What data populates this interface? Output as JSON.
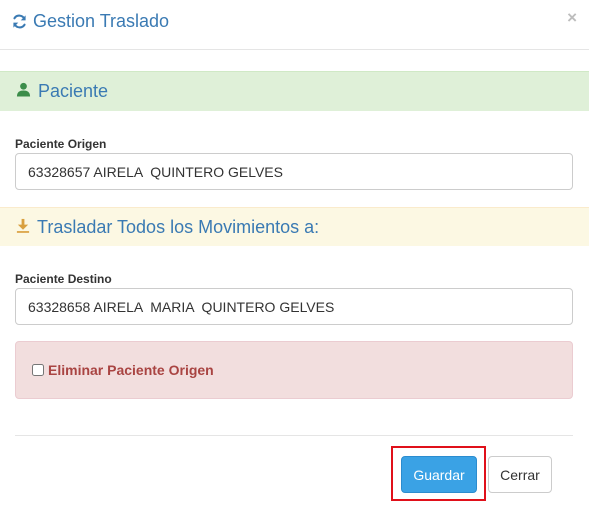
{
  "modal": {
    "title": "Gestion Traslado",
    "close_symbol": "×",
    "title_icon": "refresh-icon"
  },
  "section_patient": {
    "heading": "Paciente",
    "icon": "user-icon",
    "color": "#dff0d8"
  },
  "origin": {
    "label": "Paciente Origen",
    "value": "63328657 AIRELA  QUINTERO GELVES"
  },
  "section_transfer": {
    "heading": "Trasladar Todos los Movimientos a:",
    "icon": "download-icon",
    "color": "#fcf8e3"
  },
  "destination": {
    "label": "Paciente Destino",
    "value": "63328658 AIRELA  MARIA  QUINTERO GELVES"
  },
  "delete_origin": {
    "label": "Eliminar Paciente Origen",
    "checked": false,
    "color": "#a94442"
  },
  "footer": {
    "save_label": "Guardar",
    "close_label": "Cerrar",
    "accent": "#3aa2e5",
    "highlight_color": "#e0101a"
  }
}
